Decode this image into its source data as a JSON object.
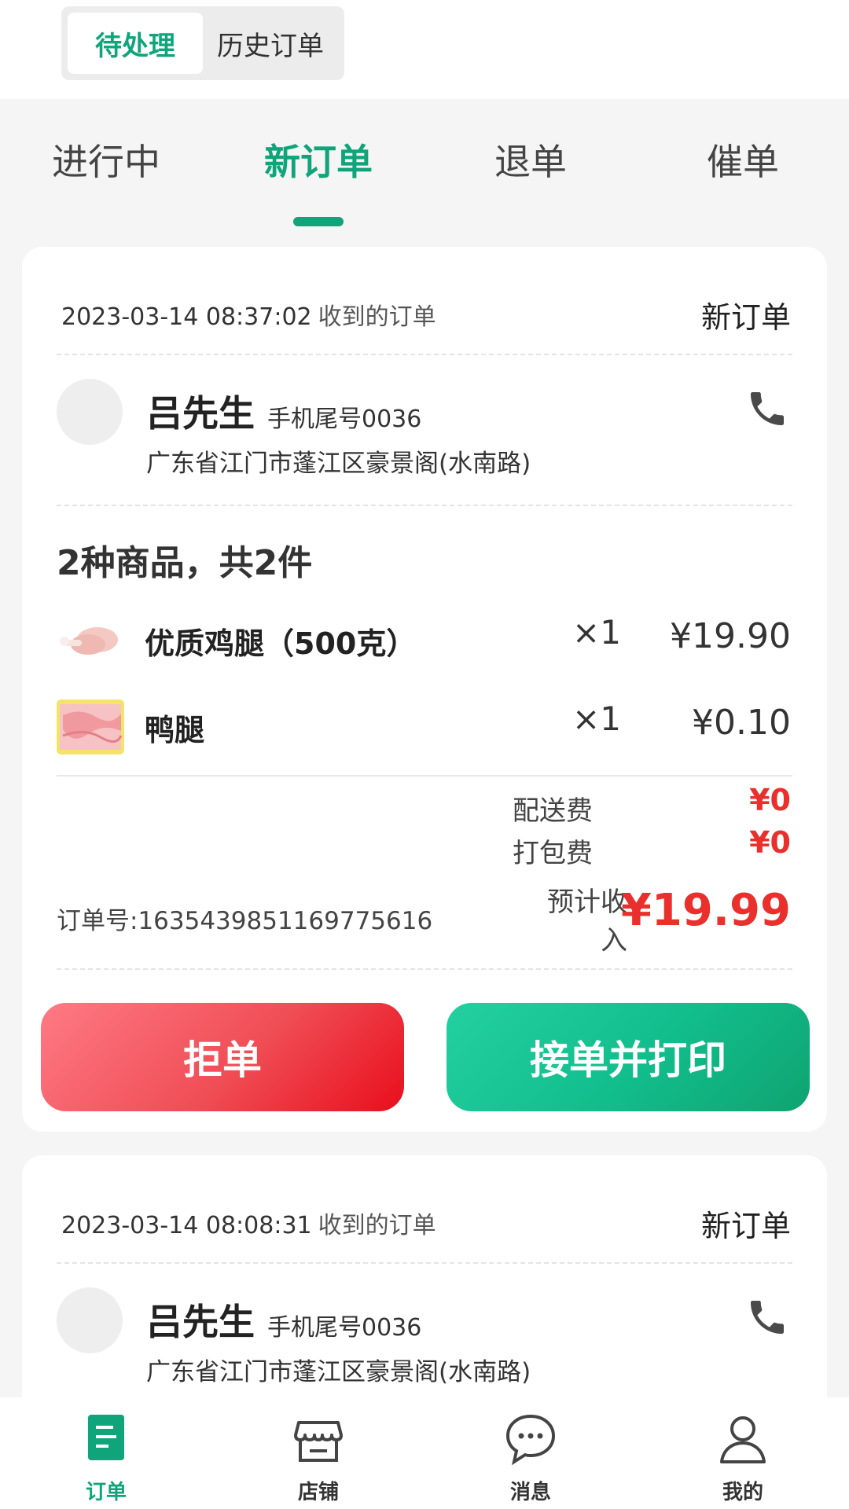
{
  "top_segment": {
    "pending": "待处理",
    "history": "历史订单"
  },
  "tabs": [
    "进行中",
    "新订单",
    "退单",
    "催单"
  ],
  "colors": {
    "accent": "#0fa47a",
    "danger": "#e9302c",
    "reject_gradient_end": "#e80e1c"
  },
  "orders": [
    {
      "time": "2023-03-14 08:37:02",
      "received_text": "收到的订单",
      "status": "新订单",
      "customer": {
        "name": "吕先生",
        "phone_tail": "手机尾号0036",
        "address": "广东省江门市蓬江区豪景阁(水南路)"
      },
      "goods_summary": "2种商品，共2件",
      "items": [
        {
          "name": "优质鸡腿（500克）",
          "qty": "×1",
          "price": "¥19.90",
          "icon": "chicken-leg-thumbnail"
        },
        {
          "name": "鸭腿",
          "qty": "×1",
          "price": "¥0.10",
          "icon": "duck-leg-thumbnail"
        }
      ],
      "delivery_fee_label": "配送费",
      "delivery_fee": "¥0",
      "packing_fee_label": "打包费",
      "packing_fee": "¥0",
      "order_no": "订单号:1635439851169775616",
      "income_label_line1": "预计收",
      "income_label_line2": "入",
      "income": "¥19.99",
      "reject_label": "拒单",
      "accept_label": "接单并打印"
    },
    {
      "time": "2023-03-14 08:08:31",
      "received_text": "收到的订单",
      "status": "新订单",
      "customer": {
        "name": "吕先生",
        "phone_tail": "手机尾号0036",
        "address": "广东省江门市蓬江区豪景阁(水南路)"
      }
    }
  ],
  "bottom_nav": [
    {
      "label": "订单",
      "icon": "order-icon"
    },
    {
      "label": "店铺",
      "icon": "store-icon"
    },
    {
      "label": "消息",
      "icon": "message-icon"
    },
    {
      "label": "我的",
      "icon": "profile-icon"
    }
  ]
}
